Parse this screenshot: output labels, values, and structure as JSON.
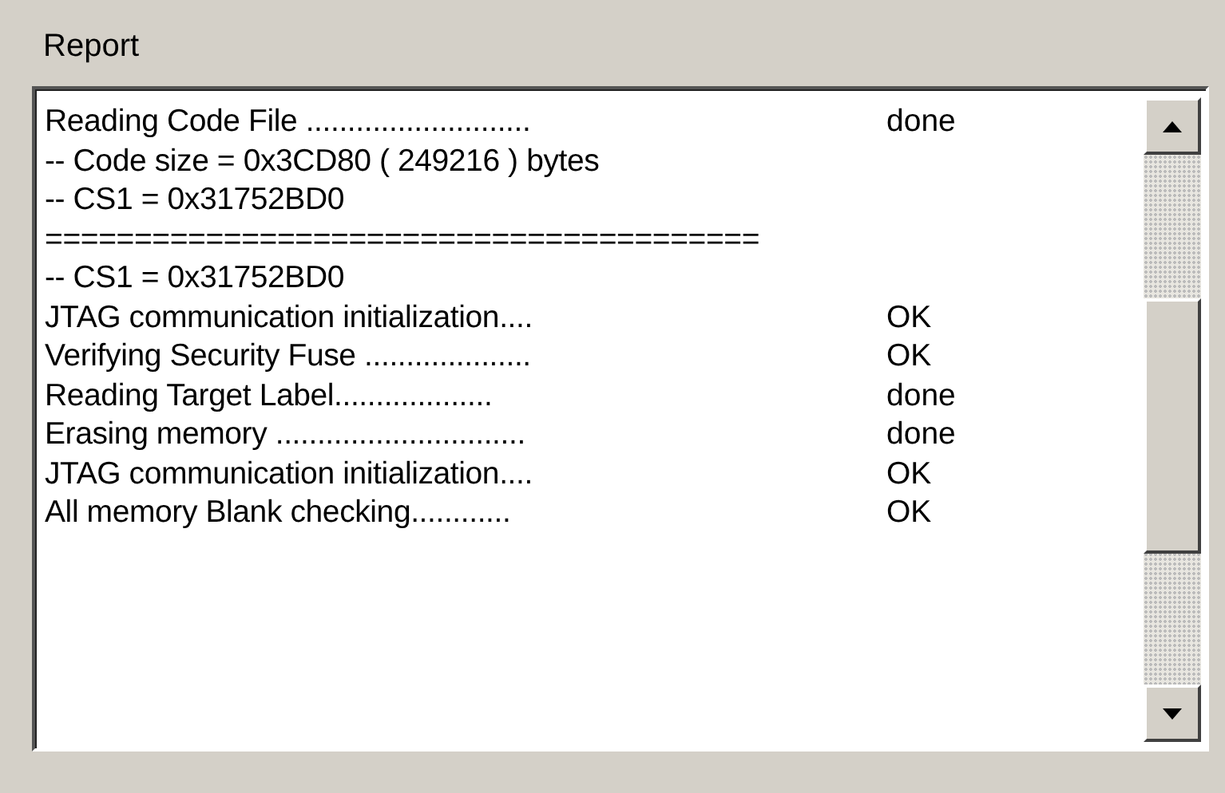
{
  "group_title": "Report",
  "report_lines": [
    {
      "text": "Reading Code File ...........................",
      "status": "done"
    },
    {
      "text": "-- Code size = 0x3CD80 ( 249216 ) bytes"
    },
    {
      "text": "-- CS1 = 0x31752BD0"
    },
    {
      "text": "========================================"
    },
    {
      "text": "-- CS1 = 0x31752BD0"
    },
    {
      "text": "JTAG communication initialization....",
      "status": "OK"
    },
    {
      "text": "Verifying Security Fuse ....................",
      "status": "OK"
    },
    {
      "text": "Reading Target Label...................",
      "status": "done"
    },
    {
      "text": "Erasing memory ..............................",
      "status": "done"
    },
    {
      "text": "JTAG communication initialization....",
      "status": "OK"
    },
    {
      "text": "All memory Blank checking............",
      "status": "OK"
    }
  ]
}
